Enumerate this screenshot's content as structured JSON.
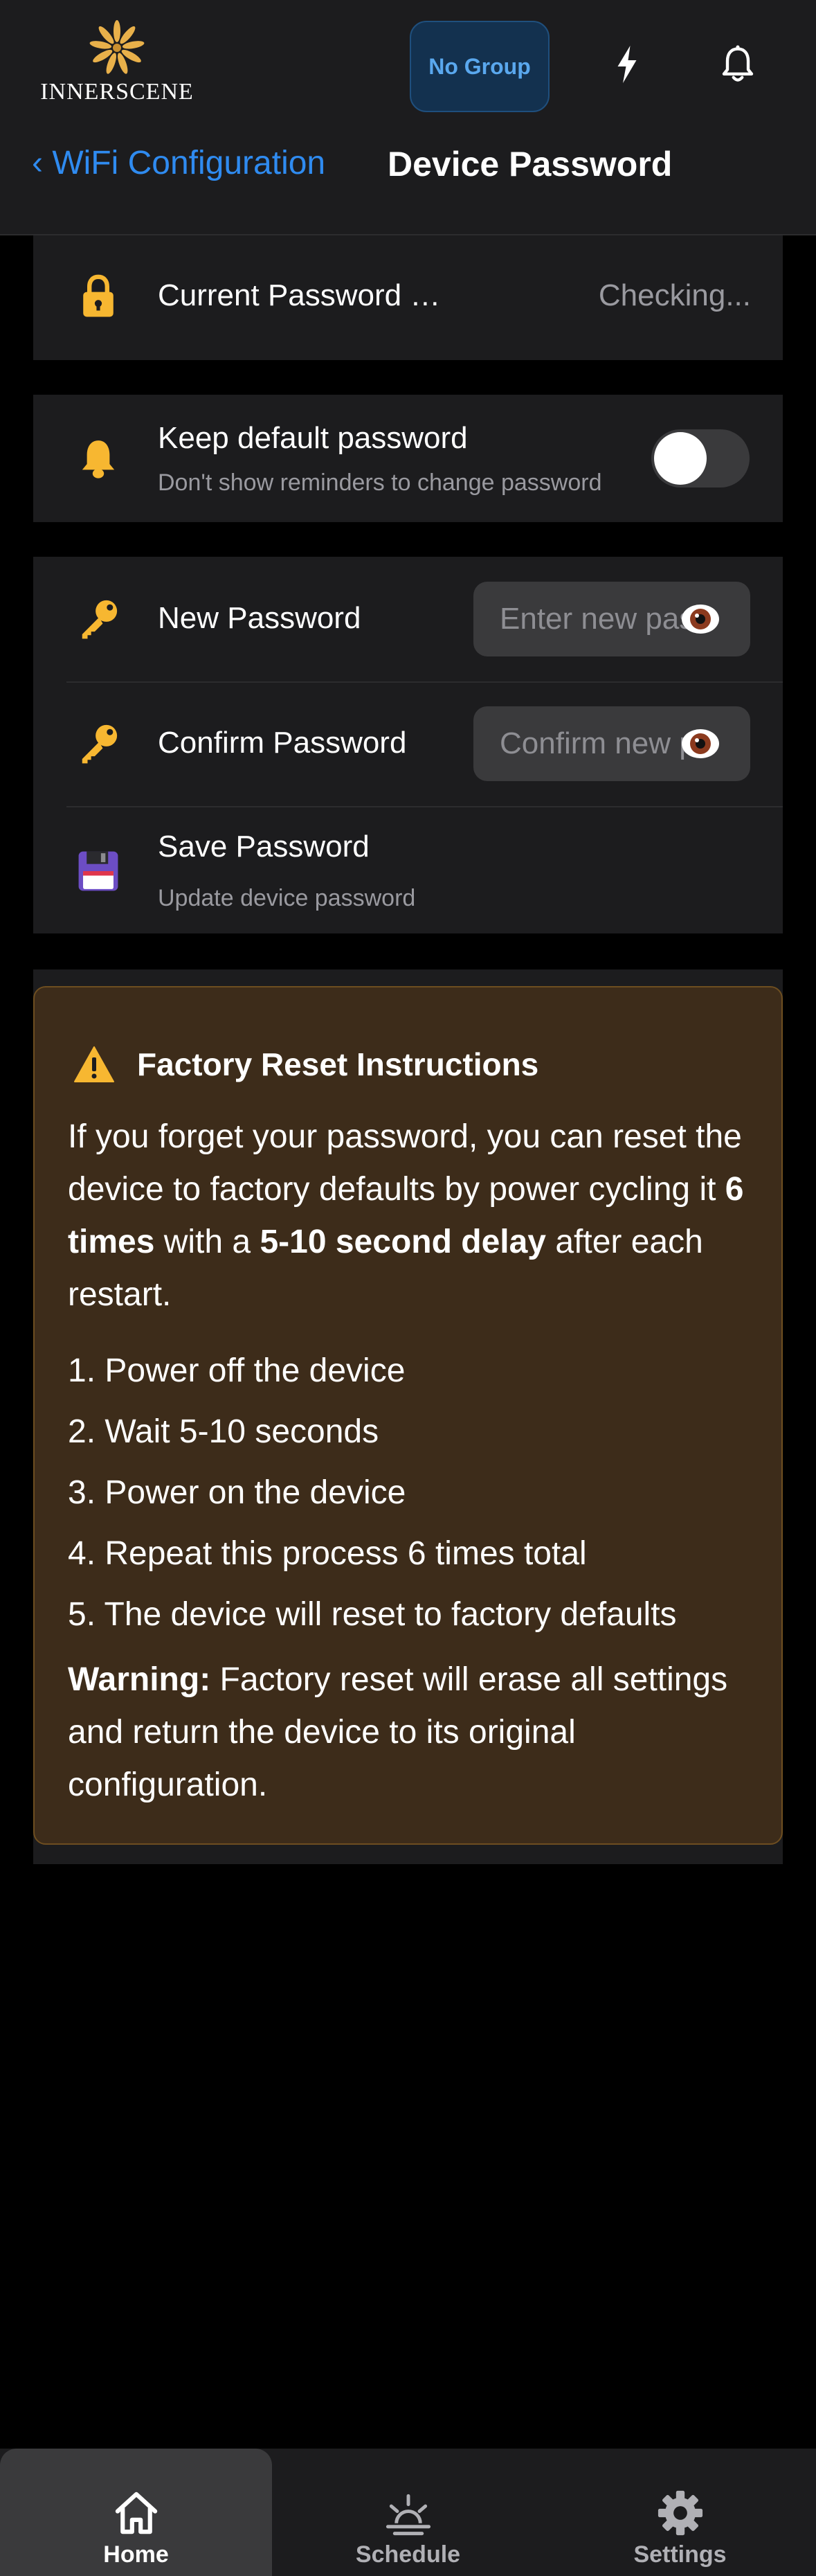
{
  "header": {
    "logo_text": "INNERSCENE",
    "group_button": "No Group",
    "icons": [
      "lightning-icon",
      "bell-icon"
    ]
  },
  "nav": {
    "back_label": "‹ WiFi Configuration",
    "title": "Device Password"
  },
  "current_password": {
    "label": "Current Password …",
    "status": "Checking...",
    "icon": "lock-icon"
  },
  "keep_default": {
    "label": "Keep default password",
    "description": "Don't show reminders to change password",
    "enabled": false,
    "icon": "bell-icon"
  },
  "new_password": {
    "label": "New Password",
    "placeholder": "Enter new password",
    "value": "",
    "icon": "key-icon"
  },
  "confirm_password": {
    "label": "Confirm Password",
    "placeholder": "Confirm new password",
    "value": "",
    "icon": "key-icon"
  },
  "save": {
    "label": "Save Password",
    "description": "Update device password",
    "icon": "floppy-disk-icon"
  },
  "factory_reset": {
    "title": "Factory Reset Instructions",
    "intro_1": "If you forget your password, you can reset the device to factory defaults by power cycling it ",
    "intro_bold_1": "6 times",
    "intro_2": " with a ",
    "intro_bold_2": "5-10 second delay",
    "intro_3": " after each restart.",
    "steps": [
      "1. Power off the device",
      "2. Wait 5-10 seconds",
      "3. Power on the device",
      "4. Repeat this process 6 times total",
      "5. The device will reset to factory defaults"
    ],
    "warning_label": "Warning:",
    "warning_text": " Factory reset will erase all settings and return the device to its original configuration."
  },
  "tabs": [
    {
      "label": "Home",
      "icon": "home-icon",
      "active": true
    },
    {
      "label": "Schedule",
      "icon": "sunrise-icon",
      "active": false
    },
    {
      "label": "Settings",
      "icon": "gear-icon",
      "active": false
    }
  ],
  "colors": {
    "accent": "#2f8bf0",
    "icon_gold": "#f7b731",
    "warning_bg": "#3d2c1a",
    "warning_border": "#6e4e20"
  }
}
